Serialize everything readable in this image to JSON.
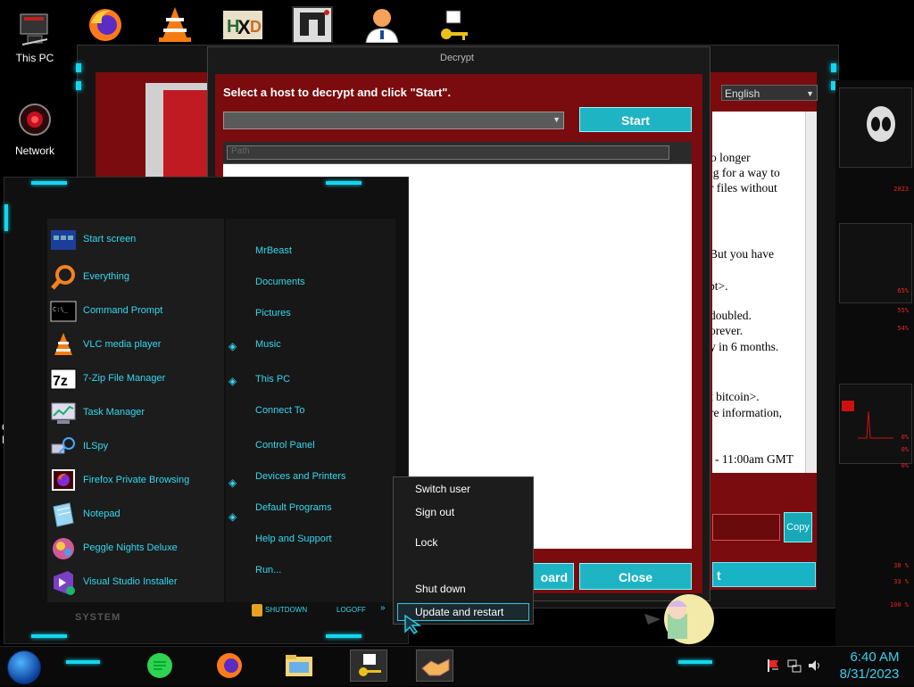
{
  "desktop": {
    "icons": [
      {
        "label": "This PC"
      },
      {
        "label": "Network"
      }
    ],
    "partial_labels": [
      "C",
      "C",
      "H"
    ]
  },
  "bg_window": {
    "language": "English",
    "ransom_lines": [
      "o longer",
      "ng for a way to",
      "r files without",
      "But you have",
      "pt>.",
      "doubled.",
      "orever.",
      "y in 6 months.",
      "t bitcoin>.",
      "re information,",
      "- 11:00am GMT"
    ],
    "copy_label": "Copy",
    "right_button_fragment": "t"
  },
  "decrypt": {
    "title": "Decrypt",
    "heading": "Select a host to decrypt and click \"Start\".",
    "host_value": "",
    "start_label": "Start",
    "log_header": "Path",
    "clipboard_fragment": "oard",
    "close_label": "Close"
  },
  "start_menu": {
    "programs": [
      {
        "label": "Start screen",
        "icon": "start-screen-icon"
      },
      {
        "label": "Everything",
        "icon": "everything-search-icon"
      },
      {
        "label": "Command Prompt",
        "icon": "command-prompt-icon"
      },
      {
        "label": "VLC media player",
        "icon": "vlc-icon"
      },
      {
        "label": "7-Zip File Manager",
        "icon": "7zip-icon"
      },
      {
        "label": "Task Manager",
        "icon": "task-manager-icon"
      },
      {
        "label": "ILSpy",
        "icon": "ilspy-icon"
      },
      {
        "label": "Firefox Private Browsing",
        "icon": "firefox-private-icon"
      },
      {
        "label": "Notepad",
        "icon": "notepad-icon"
      },
      {
        "label": "Peggle Nights Deluxe",
        "icon": "peggle-icon"
      },
      {
        "label": "Visual Studio Installer",
        "icon": "visual-studio-icon"
      }
    ],
    "places": [
      {
        "label": "MrBeast",
        "arrow": false
      },
      {
        "label": "Documents",
        "arrow": false
      },
      {
        "label": "Pictures",
        "arrow": false
      },
      {
        "label": "Music",
        "arrow": true
      },
      {
        "label": "This PC",
        "arrow": true
      },
      {
        "label": "Connect To",
        "arrow": false
      },
      {
        "label": "Control Panel",
        "arrow": false
      },
      {
        "label": "Devices and Printers",
        "arrow": true
      },
      {
        "label": "Default Programs",
        "arrow": true
      },
      {
        "label": "Help and Support",
        "arrow": false
      },
      {
        "label": "Run...",
        "arrow": false
      }
    ],
    "system_label": "SYSTEM",
    "shutdown_label": "SHUTDOWN",
    "logoff_label": "LOGOFF"
  },
  "power_menu": {
    "items": [
      "Switch user",
      "Sign out",
      "Lock",
      "Shut down",
      "Update and restart"
    ],
    "highlighted": "Update and restart"
  },
  "gadget": {
    "values": [
      "2023",
      "65%",
      "55%",
      "54%",
      "0%",
      "0%",
      "0%",
      "38 %",
      "33 %",
      "100 %"
    ]
  },
  "taskbar": {
    "time": "6:40 AM",
    "date": "8/31/2023"
  },
  "colors": {
    "accent": "#14d6ee",
    "ransom_red": "#7a0b0e",
    "button_teal": "#1fb4c4",
    "menu_text": "#33d8ef"
  }
}
